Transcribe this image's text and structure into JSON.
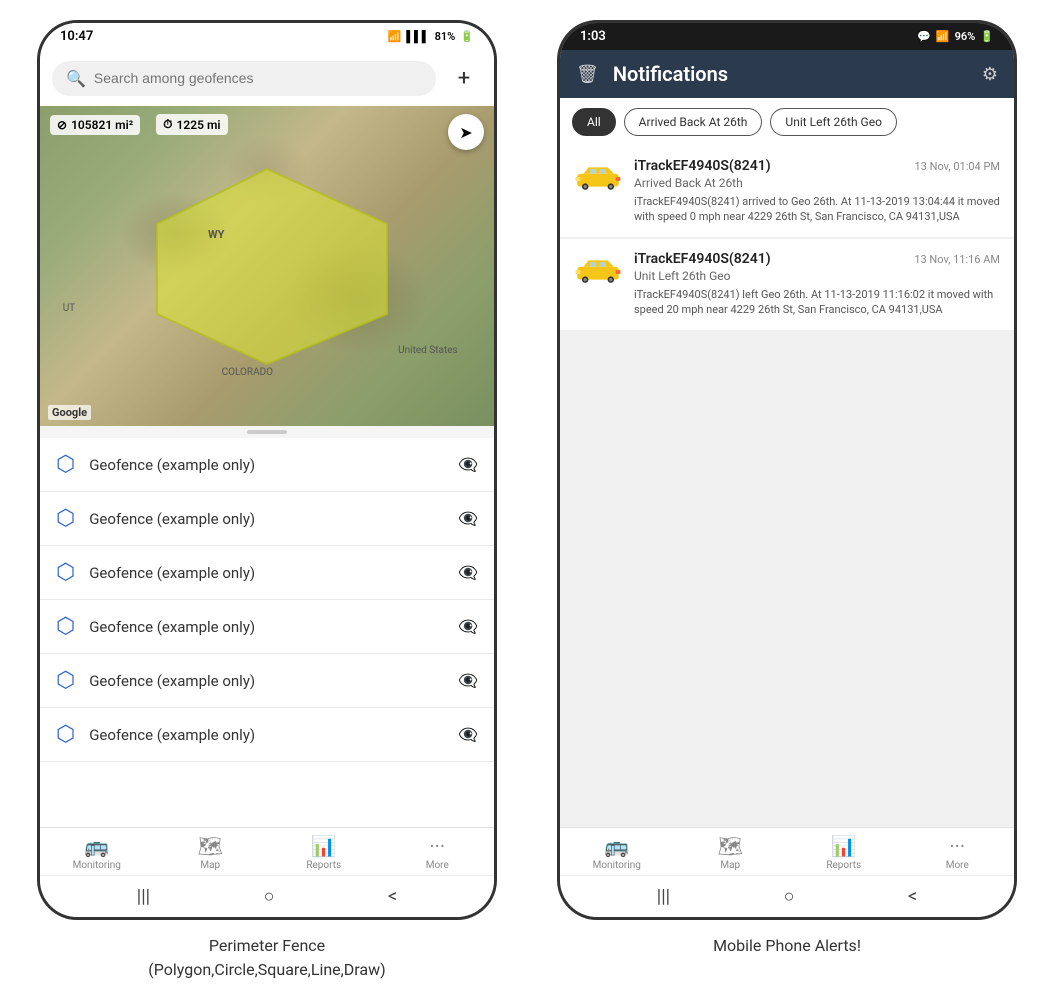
{
  "layout": {
    "left_caption": "Perimeter Fence\n(Polygon,Circle,Square,Line,Draw)",
    "right_caption": "Mobile Phone Alerts!"
  },
  "left_phone": {
    "status_bar": {
      "time": "10:47",
      "signal": "WiFi",
      "battery": "81%"
    },
    "search": {
      "placeholder": "Search among geofences"
    },
    "map": {
      "stat1": "105821 mi²",
      "stat2": "1225 mi",
      "labels": [
        "WY",
        "United States",
        "COLORADO",
        "UT"
      ],
      "logo": "Google"
    },
    "geofences": [
      {
        "name": "Geofence (example only)"
      },
      {
        "name": "Geofence (example only)"
      },
      {
        "name": "Geofence (example only)"
      },
      {
        "name": "Geofence (example only)"
      },
      {
        "name": "Geofence (example only)"
      },
      {
        "name": "Geofence (example only)"
      }
    ],
    "nav_items": [
      {
        "label": "Monitoring",
        "icon": "🚌"
      },
      {
        "label": "Map",
        "icon": "🗺"
      },
      {
        "label": "Reports",
        "icon": "📊"
      },
      {
        "label": "More",
        "icon": "···"
      }
    ],
    "android_nav": [
      "|||",
      "○",
      "<"
    ]
  },
  "right_phone": {
    "status_bar": {
      "time": "1:03",
      "battery": "96%"
    },
    "header": {
      "title": "Notifications",
      "delete_icon": "🗑",
      "settings_icon": "⚙"
    },
    "filter_tabs": [
      {
        "label": "All",
        "active": true
      },
      {
        "label": "Arrived Back At 26th",
        "active": false
      },
      {
        "label": "Unit Left 26th Geo",
        "active": false
      }
    ],
    "notifications": [
      {
        "device": "iTrackEF4940S(8241)",
        "time": "13 Nov, 01:04 PM",
        "subtitle": "Arrived Back At 26th",
        "body": "iTrackEF4940S(8241) arrived to Geo 26th.    At 11-13-2019 13:04:44 it moved with speed 0 mph near 4229 26th St, San Francisco, CA 94131,USA"
      },
      {
        "device": "iTrackEF4940S(8241)",
        "time": "13 Nov, 11:16 AM",
        "subtitle": "Unit Left 26th Geo",
        "body": "iTrackEF4940S(8241) left Geo 26th.   At 11-13-2019 11:16:02 it moved with speed 20 mph near 4229 26th St, San Francisco, CA 94131,USA"
      }
    ],
    "nav_items": [
      {
        "label": "Monitoring",
        "icon": "🚌"
      },
      {
        "label": "Map",
        "icon": "🗺"
      },
      {
        "label": "Reports",
        "icon": "📊"
      },
      {
        "label": "More",
        "icon": "···"
      }
    ],
    "android_nav": [
      "|||",
      "○",
      "<"
    ]
  }
}
